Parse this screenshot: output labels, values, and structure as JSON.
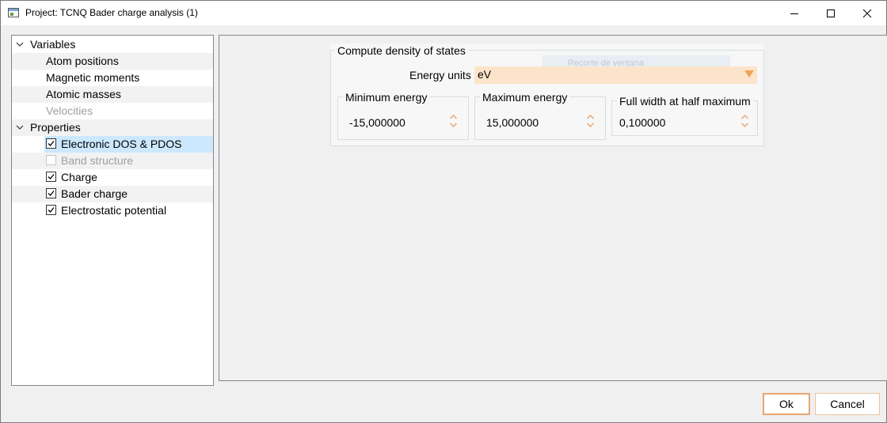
{
  "window": {
    "title": "Project: TCNQ Bader charge analysis (1)",
    "controls": [
      "minimize-icon",
      "maximize-icon",
      "close-icon"
    ]
  },
  "tree": {
    "groups": [
      {
        "label": "Variables",
        "expanded": true,
        "items": [
          {
            "label": "Atom positions",
            "enabled": true
          },
          {
            "label": "Magnetic moments",
            "enabled": true
          },
          {
            "label": "Atomic masses",
            "enabled": true
          },
          {
            "label": "Velocities",
            "enabled": false
          }
        ]
      },
      {
        "label": "Properties",
        "expanded": true,
        "items": [
          {
            "label": "Electronic DOS & PDOS",
            "checked": true,
            "enabled": true,
            "selected": true
          },
          {
            "label": "Band structure",
            "checked": false,
            "enabled": false
          },
          {
            "label": "Charge",
            "checked": true,
            "enabled": true
          },
          {
            "label": "Bader charge",
            "checked": true,
            "enabled": true
          },
          {
            "label": "Electrostatic potential",
            "checked": true,
            "enabled": true
          }
        ]
      }
    ]
  },
  "dos": {
    "section_title": "Compute density of states",
    "ghost_text": "Recorte de ventana",
    "energy_units_label": "Energy units",
    "energy_units_value": "eV",
    "min_energy": {
      "label": "Minimum energy",
      "value": "-15,000000"
    },
    "max_energy": {
      "label": "Maximum energy",
      "value": "15,000000"
    },
    "fwhm": {
      "label": "Full width at half maximum",
      "value": "0,100000"
    }
  },
  "buttons": {
    "ok": "Ok",
    "cancel": "Cancel"
  },
  "colors": {
    "selection": "#cce8ff",
    "accent_orange": "#e8a66f",
    "combo_background": "#fce4cb",
    "disabled_text": "#a0a0a0"
  }
}
